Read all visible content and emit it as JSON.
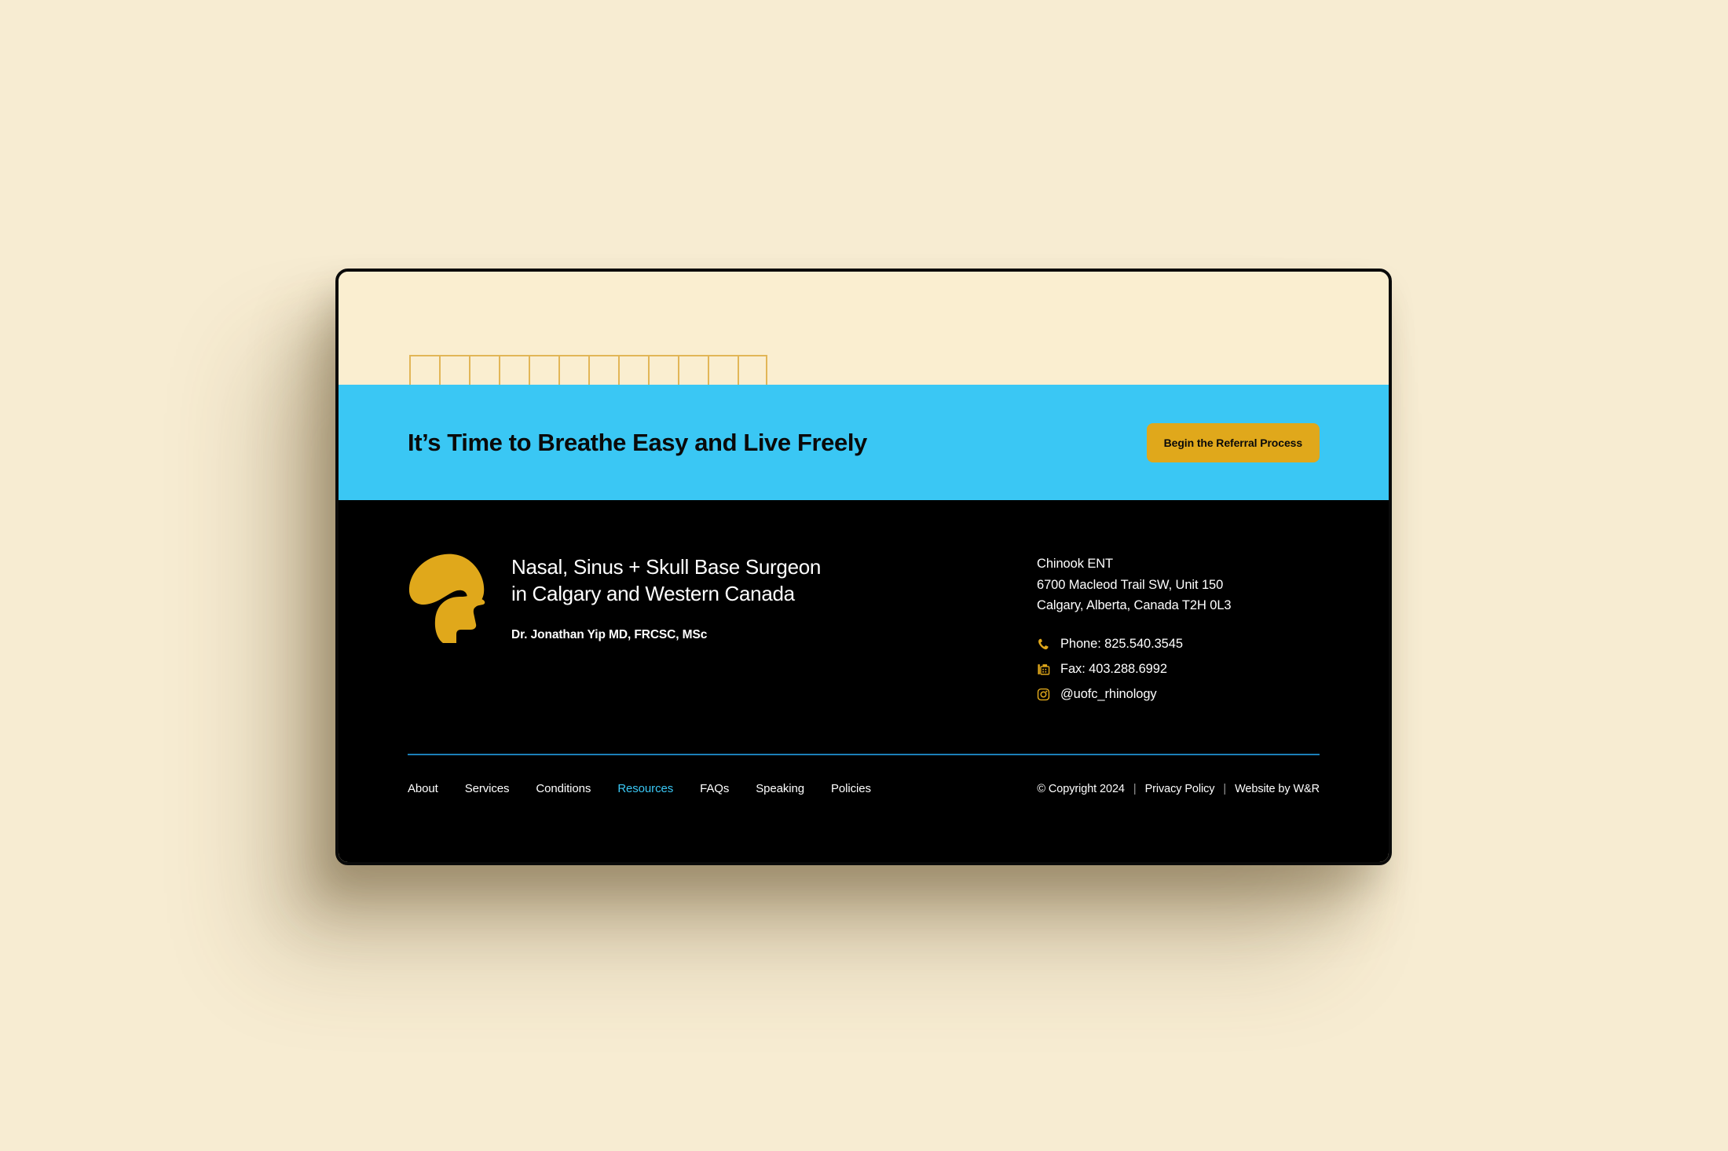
{
  "colors": {
    "page_background": "#f7ecd2",
    "viewport_background": "#faeed0",
    "cta_band": "#3ac7f4",
    "brand_gold": "#e0a81b",
    "grid_outline": "#e2b657",
    "footer_background": "#000000",
    "divider": "#1b7fb8",
    "active_link": "#3ac7f4"
  },
  "decor": {
    "grid_cells": 12
  },
  "cta": {
    "headline": "It’s Time to Breathe Easy and Live Freely",
    "button_label": "Begin the Referral Process"
  },
  "footer": {
    "logo_name": "head-profile-logo",
    "brand_title": "Nasal, Sinus + Skull Base Surgeon\nin Calgary and Western Canada",
    "brand_subtitle": "Dr. Jonathan Yip MD, FRCSC, MSc",
    "contact": {
      "clinic_name": "Chinook ENT",
      "address_line1": "6700 Macleod Trail SW, Unit 150",
      "address_line2": "Calgary, Alberta, Canada T2H 0L3",
      "items": [
        {
          "icon": "phone-icon",
          "label": "Phone: 825.540.3545"
        },
        {
          "icon": "fax-icon",
          "label": "Fax: 403.288.6992"
        },
        {
          "icon": "instagram-icon",
          "label": "@uofc_rhinology"
        }
      ]
    },
    "nav": [
      {
        "label": "About",
        "active": false
      },
      {
        "label": "Services",
        "active": false
      },
      {
        "label": "Conditions",
        "active": false
      },
      {
        "label": "Resources",
        "active": true
      },
      {
        "label": "FAQs",
        "active": false
      },
      {
        "label": "Speaking",
        "active": false
      },
      {
        "label": "Policies",
        "active": false
      }
    ],
    "legal": {
      "copyright": "© Copyright 2024",
      "separator": "|",
      "privacy": "Privacy Policy",
      "credit": "Website by W&R"
    }
  }
}
